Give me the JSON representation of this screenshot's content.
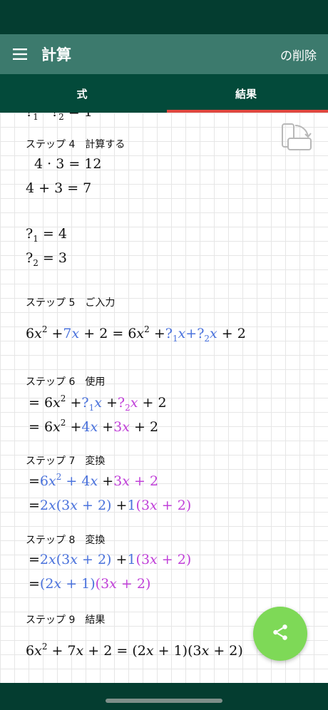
{
  "app_bar": {
    "title": "計算",
    "delete_label": "の削除"
  },
  "tabs": [
    {
      "label": "式"
    },
    {
      "label": "結果"
    }
  ],
  "steps": {
    "s4": {
      "label": "ステップ 4　計算する"
    },
    "s5": {
      "label": "ステップ 5　ご入力"
    },
    "s6": {
      "label": "ステップ 6　使用"
    },
    "s7": {
      "label": "ステップ 7　変換"
    },
    "s8": {
      "label": "ステップ 8　変換"
    },
    "s9": {
      "label": "ステップ 9　結果"
    }
  },
  "colors": {
    "header": "#3c7a6d",
    "tabs": "#034a3a",
    "indicator": "#e0473f",
    "blue": "#4a72dc",
    "magenta": "#c040d8",
    "fab": "#7ed957"
  },
  "icons": {
    "menu": "menu-icon",
    "rotate": "screen-rotate-icon",
    "share": "share-icon"
  }
}
